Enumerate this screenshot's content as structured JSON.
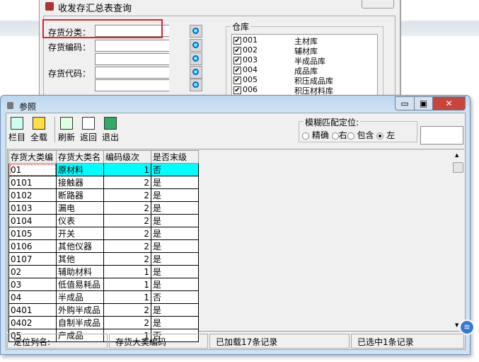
{
  "query_dialog": {
    "title": "收发存汇总表查询",
    "close_label": "X",
    "fields": [
      {
        "label": "存货分类："
      },
      {
        "label": "存货编码："
      },
      {
        "label": "存货代码："
      }
    ],
    "warehouse_group": "仓库",
    "warehouses": [
      {
        "code": "001",
        "name": "主材库",
        "checked": true
      },
      {
        "code": "002",
        "name": "辅材库",
        "checked": true
      },
      {
        "code": "003",
        "name": "半成品库",
        "checked": true
      },
      {
        "code": "004",
        "name": "成品库",
        "checked": true
      },
      {
        "code": "005",
        "name": "积压成品库",
        "checked": true
      },
      {
        "code": "006",
        "name": "积压材料库",
        "checked": true
      }
    ]
  },
  "refer_window": {
    "title": "参照",
    "toolbar": [
      {
        "label": "栏目",
        "icon": "columns-icon"
      },
      {
        "label": "全载",
        "icon": "load-all-icon"
      },
      {
        "label": "刷新",
        "icon": "refresh-icon"
      },
      {
        "label": "返回",
        "icon": "return-icon"
      },
      {
        "label": "退出",
        "icon": "exit-icon"
      }
    ],
    "fuzzy": {
      "label": "模糊匹配定位:",
      "options": [
        "精确",
        "右",
        "包含",
        "左"
      ],
      "selected": "左",
      "input_value": ""
    },
    "columns": [
      "存货大类编",
      "存货大类名",
      "编码级次",
      "是否末级"
    ],
    "rows": [
      [
        "01",
        "原材料",
        "1",
        "否"
      ],
      [
        "0101",
        "接触器",
        "2",
        "是"
      ],
      [
        "0102",
        "断路器",
        "2",
        "是"
      ],
      [
        "0103",
        "漏电",
        "2",
        "是"
      ],
      [
        "0104",
        "仪表",
        "2",
        "是"
      ],
      [
        "0105",
        "开关",
        "2",
        "是"
      ],
      [
        "0106",
        "其他仪器",
        "2",
        "是"
      ],
      [
        "0107",
        "其他",
        "2",
        "是"
      ],
      [
        "02",
        "辅助材料",
        "1",
        "是"
      ],
      [
        "03",
        "低值易耗品",
        "1",
        "是"
      ],
      [
        "04",
        "半成品",
        "1",
        "否"
      ],
      [
        "0401",
        "外购半成品",
        "2",
        "是"
      ],
      [
        "0402",
        "自制半成品",
        "2",
        "是"
      ],
      [
        "05",
        "产成品",
        "1",
        "否"
      ]
    ],
    "selected_row": 0,
    "status": {
      "locate_label": "定位列名:",
      "locate_value": "存货大类编码",
      "loaded": "已加载17条记录",
      "selected": "已选中1条记录"
    }
  },
  "colors": {
    "selected_row": "#00ffff",
    "highlight_box": "#e0222a"
  }
}
